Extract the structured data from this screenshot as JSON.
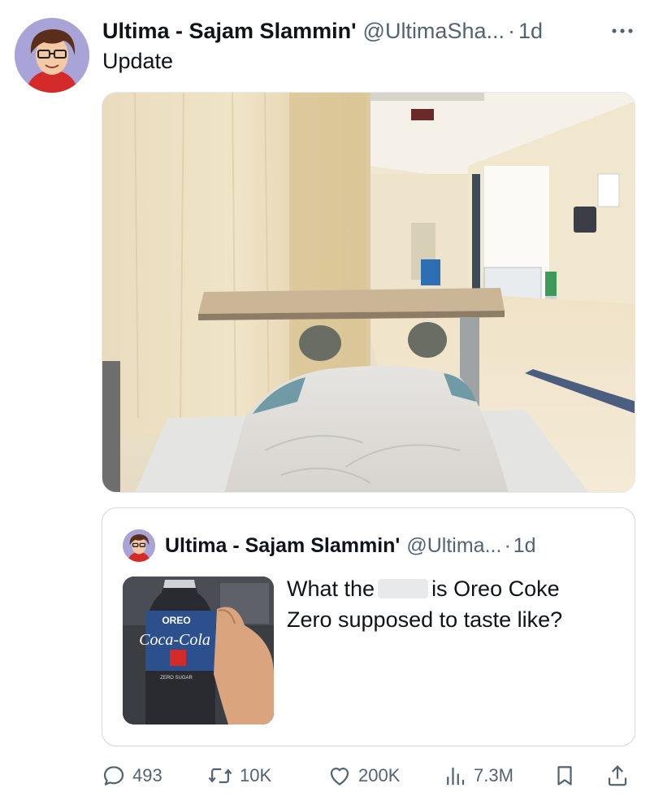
{
  "tweet": {
    "display_name": "Ultima - Sajam Slammin'",
    "handle": "@UltimaSha...",
    "separator": "·",
    "time": "1d",
    "text": "Update"
  },
  "quoted_tweet": {
    "display_name": "Ultima - Sajam Slammin'",
    "handle": "@Ultima...",
    "separator": "·",
    "time": "1d",
    "text_before": "What the",
    "text_after": "is Oreo Coke",
    "text_line2": "Zero supposed to taste like?",
    "bottle_brand": "OREO",
    "bottle_label": "Coca-Cola",
    "bottle_sub": "ZERO SUGAR"
  },
  "actions": {
    "replies": "493",
    "reposts": "10K",
    "likes": "200K",
    "views": "7.3M"
  },
  "icons": [
    "more-icon",
    "reply-icon",
    "repost-icon",
    "like-icon",
    "views-icon",
    "bookmark-icon",
    "share-icon"
  ],
  "colors": {
    "text_primary": "#0f1419",
    "text_secondary": "#536471",
    "border": "#cfd9de",
    "avatar_bg": "#a9a4d8"
  }
}
